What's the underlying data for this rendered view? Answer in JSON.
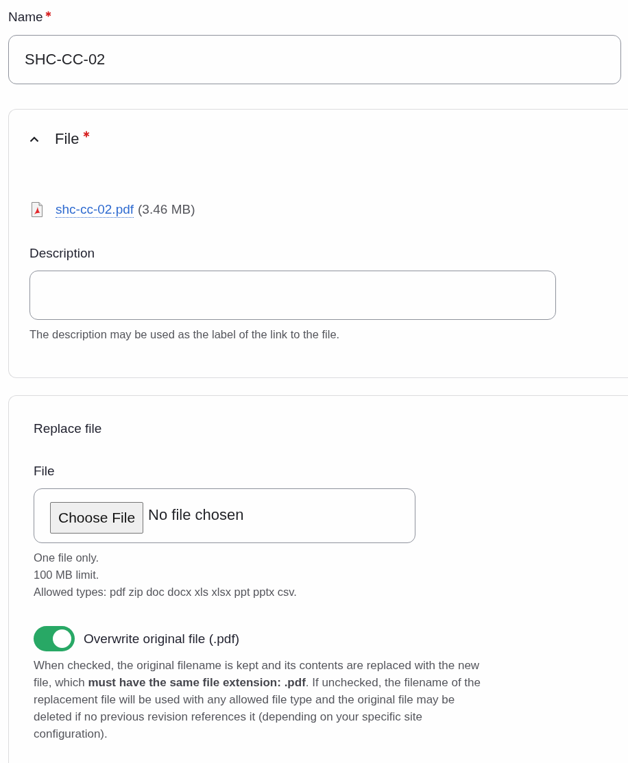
{
  "name_field": {
    "label": "Name",
    "required": true,
    "value": "SHC-CC-02"
  },
  "file_section": {
    "title": "File",
    "required": true,
    "expanded": true,
    "file": {
      "link": "shc-cc-02.pdf",
      "size": "(3.46 MB)"
    },
    "description": {
      "label": "Description",
      "help": "The description may be used as the label of the link to the file."
    }
  },
  "replace_section": {
    "title": "Replace file",
    "file_field": {
      "label": "File",
      "button": "Choose File",
      "status": "No file chosen",
      "help": [
        "One file only.",
        "100 MB limit.",
        "Allowed types: pdf zip doc docx xls xlsx ppt pptx csv."
      ]
    },
    "overwrite": {
      "label": "Overwrite original file (.pdf)",
      "on": true,
      "description": "When checked, the original filename is kept and its contents are replaced with the new file, which **must have the same file extension: .pdf**. If unchecked, the filename of the replacement file will be used with any allowed file type and the original file may be deleted if no previous revision references it (depending on your specific site configuration)."
    }
  }
}
